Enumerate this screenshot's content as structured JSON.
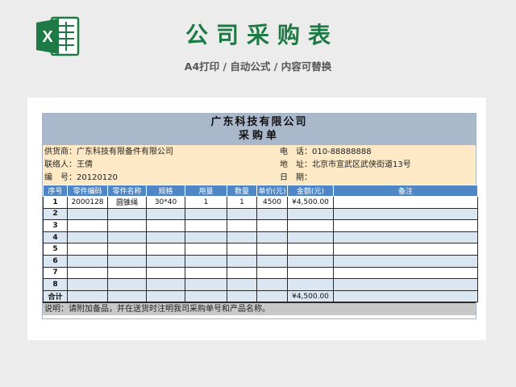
{
  "header": {
    "title": "公司采购表",
    "subtitle": "A4打印 / 自动公式 / 内容可替换",
    "logo_icon": "excel-logo-icon",
    "logo_letter": "X"
  },
  "sheet": {
    "company": "广东科技有限公司",
    "doc_title": "采购单",
    "info": {
      "supplier": "供货商：广东科技有限备件有限公司",
      "phone": "电　话：010-88888888",
      "contact": "联络人：王倩",
      "address": "地　址：北京市宣武区武侠街道13号",
      "number": "编　号：20120120",
      "date": "日　期："
    },
    "columns": [
      "序号",
      "零件编码",
      "零件名称",
      "规格",
      "用量",
      "数量",
      "单价(元)",
      "金额(元)",
      "备注"
    ],
    "rows": [
      [
        "1",
        "2000128",
        "圆锥绳",
        "30*40",
        "1",
        "1",
        "4500",
        "¥4,500.00",
        ""
      ],
      [
        "2",
        "",
        "",
        "",
        "",
        "",
        "",
        "",
        ""
      ],
      [
        "3",
        "",
        "",
        "",
        "",
        "",
        "",
        "",
        ""
      ],
      [
        "4",
        "",
        "",
        "",
        "",
        "",
        "",
        "",
        ""
      ],
      [
        "5",
        "",
        "",
        "",
        "",
        "",
        "",
        "",
        ""
      ],
      [
        "6",
        "",
        "",
        "",
        "",
        "",
        "",
        "",
        ""
      ],
      [
        "7",
        "",
        "",
        "",
        "",
        "",
        "",
        "",
        ""
      ],
      [
        "8",
        "",
        "",
        "",
        "",
        "",
        "",
        "",
        ""
      ]
    ],
    "total_label": "合计",
    "total_value": "¥4,500.00",
    "note": "说明：请附加备品，并在送货时注明我司采购单号和产品名称。"
  },
  "colors": {
    "brand": "#1e7a45",
    "header_band": "#aab8cc",
    "info_band": "#fde9c6",
    "column_header": "#4f86c6",
    "row_alt": "#dbe6f3"
  }
}
